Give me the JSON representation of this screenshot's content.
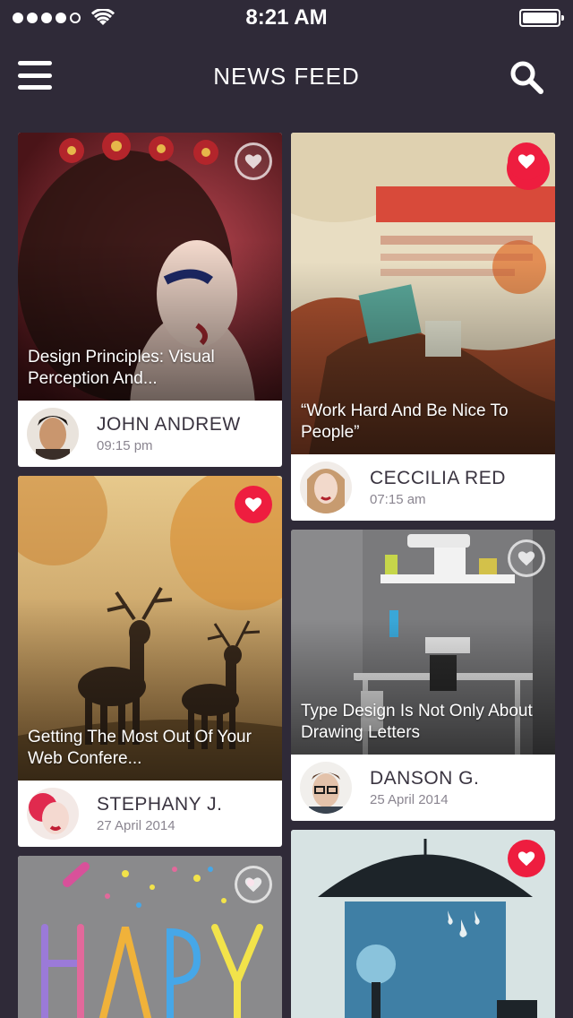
{
  "status_bar": {
    "time": "8:21 AM",
    "signal_bars": 4,
    "battery_level": 1.0
  },
  "header": {
    "title": "NEWS FEED",
    "menu_icon": "hamburger-menu-icon",
    "search_icon": "search-icon"
  },
  "colors": {
    "background": "#2f2a38",
    "accent": "#ee1d3f",
    "card": "#ffffff",
    "author_text": "#3a3440",
    "meta_text": "#8a8590"
  },
  "cards": [
    {
      "caption": "Design Principles: Visual Perception And...",
      "author": "JOHN ANDREW",
      "time": "09:15 pm",
      "liked": false
    },
    {
      "caption": "“Work Hard And Be Nice To People”",
      "author": "CECCILIA RED",
      "time": "07:15 am",
      "liked": true
    },
    {
      "caption": "Getting The Most Out Of Your Web Confere...",
      "author": "STEPHANY J.",
      "time": "27 April 2014",
      "liked": true
    },
    {
      "caption": "Type Design Is Not Only About Drawing Letters",
      "author": "DANSON G.",
      "time": "25 April 2014",
      "liked": false
    },
    {
      "caption": "",
      "author": "",
      "time": "",
      "liked": false
    },
    {
      "caption": "",
      "author": "",
      "time": "",
      "liked": true
    }
  ]
}
